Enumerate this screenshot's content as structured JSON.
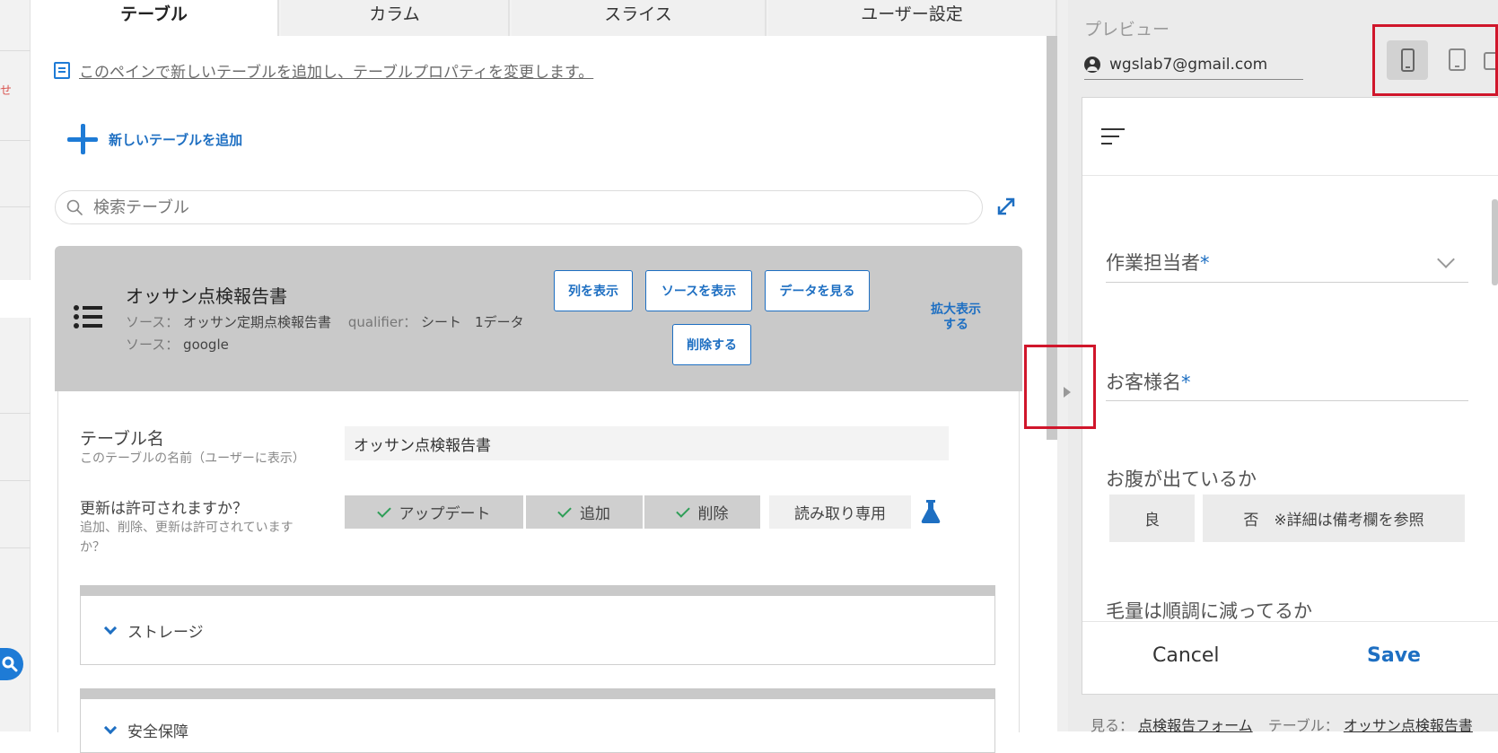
{
  "rail": {
    "red_char": "せ"
  },
  "tabs": [
    {
      "label": "テーブル"
    },
    {
      "label": "カラム"
    },
    {
      "label": "スライス"
    },
    {
      "label": "ユーザー設定"
    }
  ],
  "main": {
    "info_text": "このペインで新しいテーブルを追加し、テーブルプロパティを変更します。",
    "add_table_label": "新しいテーブルを追加",
    "search_placeholder": "検索テーブル"
  },
  "card": {
    "title": "オッサン点検報告書",
    "source_label": "ソース：",
    "source_value": "オッサン定期点検報告書",
    "qualifier_label": "qualifier：",
    "qualifier_value": "シート　1データ",
    "source2_label": "ソース：",
    "source2_value": "google",
    "buttons": {
      "show_columns": "列を表示",
      "show_source": "ソースを表示",
      "view_data": "データを見る",
      "delete": "削除する"
    },
    "expand_line1": "拡大表示",
    "expand_line2": "する"
  },
  "form": {
    "table_name_label": "テーブル名",
    "table_name_help": "このテーブルの名前（ユーザーに表示）",
    "table_name_value": "オッサン点検報告書",
    "updates_label": "更新は許可されますか？",
    "updates_help": "追加、削除、更新は許可されていますか？",
    "perm_update": "アップデート",
    "perm_add": "追加",
    "perm_delete": "削除",
    "perm_readonly": "読み取り専用",
    "section_storage": "ストレージ",
    "section_security": "安全保障"
  },
  "preview": {
    "label": "プレビュー",
    "email": "wgslab7@gmail.com",
    "fields": [
      {
        "label": "作業担当者"
      },
      {
        "label": "お客様名"
      },
      {
        "label": "お腹が出ているか"
      },
      {
        "label": "毛量は順調に減ってるか"
      }
    ],
    "required_mark": "*",
    "option_good": "良",
    "option_bad": "否　※詳細は備考欄を参照",
    "cancel": "Cancel",
    "save": "Save",
    "footer_view_label": "見る：",
    "footer_view_value": "点検報告フォーム",
    "footer_table_label": "テーブル：",
    "footer_table_value": "オッサン点検報告書"
  },
  "colors": {
    "accent": "#1e6fc2",
    "highlight": "#d0162b",
    "check": "#2e9e57"
  }
}
